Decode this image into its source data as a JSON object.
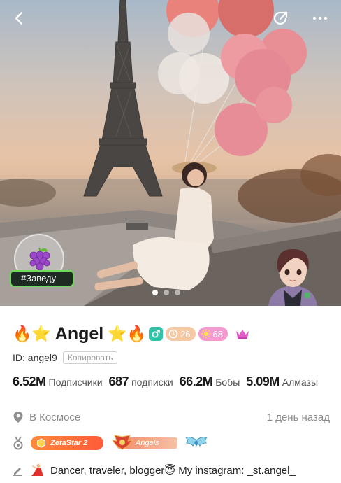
{
  "header": {
    "back_icon": "chevron-left-icon",
    "share_icon": "share-icon",
    "more_icon": "more-horizontal-icon"
  },
  "room_badge": {
    "icon": "grapes-icon",
    "label": "#Заведу"
  },
  "carousel": {
    "count": 3,
    "active": 0
  },
  "profile": {
    "name": "Angel",
    "name_prefix_emojis": "🔥⭐",
    "name_suffix_emojis": "⭐🔥",
    "level_badge": "26",
    "sun_badge": "68",
    "crown_icon": "crown-icon",
    "id_label": "ID: angel9",
    "copy_label": "Копировать"
  },
  "stats": [
    {
      "value": "6.52M",
      "label": "Подписчики"
    },
    {
      "value": "687",
      "label": "подписки"
    },
    {
      "value": "66.2M",
      "label": "Бобы"
    },
    {
      "value": "5.09M",
      "label": "Алмазы"
    }
  ],
  "location": {
    "icon": "location-pin-icon",
    "text": "В Космосе",
    "time": "1 день назад"
  },
  "medals": {
    "icon": "medal-icon",
    "zeta_label": "ZetaStar 2",
    "angels_label": "Angels"
  },
  "bio": {
    "icon": "pencil-icon",
    "text": "Dancer, traveler, blogger😇 My instagram: _st.angel_"
  },
  "colors": {
    "accent_teal": "#2ec4a8",
    "level_pill": "#f5c9a4",
    "sun_pill": "#f59ad1",
    "crown": "#e25cc7",
    "room_tag_border": "#6fdc57"
  }
}
